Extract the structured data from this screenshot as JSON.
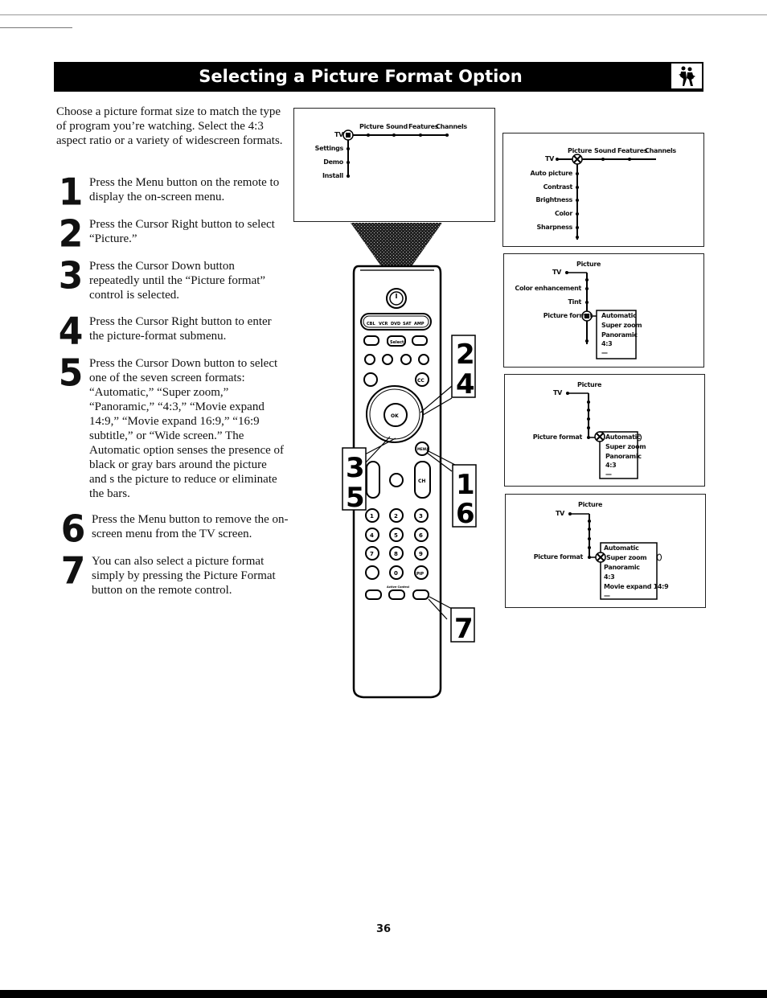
{
  "header": {
    "title": "Selecting a Picture Format Option",
    "icon": "figures-icon"
  },
  "intro": "Choose a picture format size to match the type of program you’re watching. Select the 4:3 aspect ratio or a variety of widescreen formats.",
  "steps": [
    {
      "number": "1",
      "text": "Press the Menu button on the remote to display the on-screen menu."
    },
    {
      "number": "2",
      "text": "Press the Cursor Right button to select “Picture.”"
    },
    {
      "number": "3",
      "text": "Press the Cursor Down button repeatedly until the “Picture format” control is selected."
    },
    {
      "number": "4",
      "text": "Press the Cursor Right button to enter the picture-format submenu."
    },
    {
      "number": "5",
      "text": "Press the Cursor Down button to select one of the seven screen formats: “Automatic,” “Super zoom,” “Panoramic,” “4:3,” “Movie expand 14:9,” “Movie expand 16:9,” “16:9 subtitle,” or “Wide screen.” The Automatic option senses the presence of black or gray bars around the picture and s the picture to reduce or eliminate the bars."
    },
    {
      "number": "6",
      "text": "Press the Menu button to remove the on-screen menu from the TV screen."
    },
    {
      "number": "7",
      "text": "You can also select a picture format simply by pressing the Picture Format button on the remote control."
    }
  ],
  "screens": {
    "main_menu": {
      "root": "TV",
      "top_items": [
        "Picture",
        "Sound",
        "Features",
        "Channels"
      ],
      "side_items": [
        "Settings",
        "Demo",
        "Install"
      ]
    },
    "picture_menu": {
      "root": "TV",
      "top_items": [
        "Picture",
        "Sound",
        "Features",
        "Channels"
      ],
      "side_items": [
        "Auto picture",
        "Contrast",
        "Brightness",
        "Color",
        "Sharpness"
      ]
    },
    "picture_format_select": {
      "root": "TV",
      "header": "Picture",
      "side_items": [
        "Color enhancement",
        "Tint",
        "Picture format"
      ],
      "options": [
        "Automatic",
        "Super zoom",
        "Panoramic",
        "4:3",
        "—"
      ]
    },
    "picture_format_enter": {
      "root": "TV",
      "header": "Picture",
      "side_items": [
        "Picture format"
      ],
      "options": [
        "Automatic",
        "Super zoom",
        "Panoramic",
        "4:3",
        "—"
      ]
    },
    "picture_format_scroll": {
      "root": "TV",
      "header": "Picture",
      "side_items": [
        "Picture format"
      ],
      "options": [
        "Automatic",
        "Super zoom",
        "Panoramic",
        "4:3",
        "Movie expand 14:9",
        "—"
      ]
    }
  },
  "remote": {
    "source_buttons": [
      "CBL",
      "VCR",
      "DVD",
      "SAT",
      "AMP"
    ],
    "select_label": "Select",
    "ok_label": "OK",
    "cc_label": "CC",
    "menu_label": "MENU",
    "ch_label": "CH",
    "numbers": [
      "1",
      "2",
      "3",
      "4",
      "5",
      "6",
      "7",
      "8",
      "9",
      "0"
    ],
    "pip_label": "PiP",
    "active_control_label": "Active Control",
    "callouts": [
      {
        "id": "callout-2-4",
        "lines": [
          "2",
          "4"
        ]
      },
      {
        "id": "callout-3-5",
        "lines": [
          "3",
          "5"
        ]
      },
      {
        "id": "callout-1-6",
        "lines": [
          "1",
          "6"
        ]
      },
      {
        "id": "callout-7",
        "lines": [
          "7"
        ]
      }
    ]
  },
  "footer": {
    "page_number": "36"
  }
}
